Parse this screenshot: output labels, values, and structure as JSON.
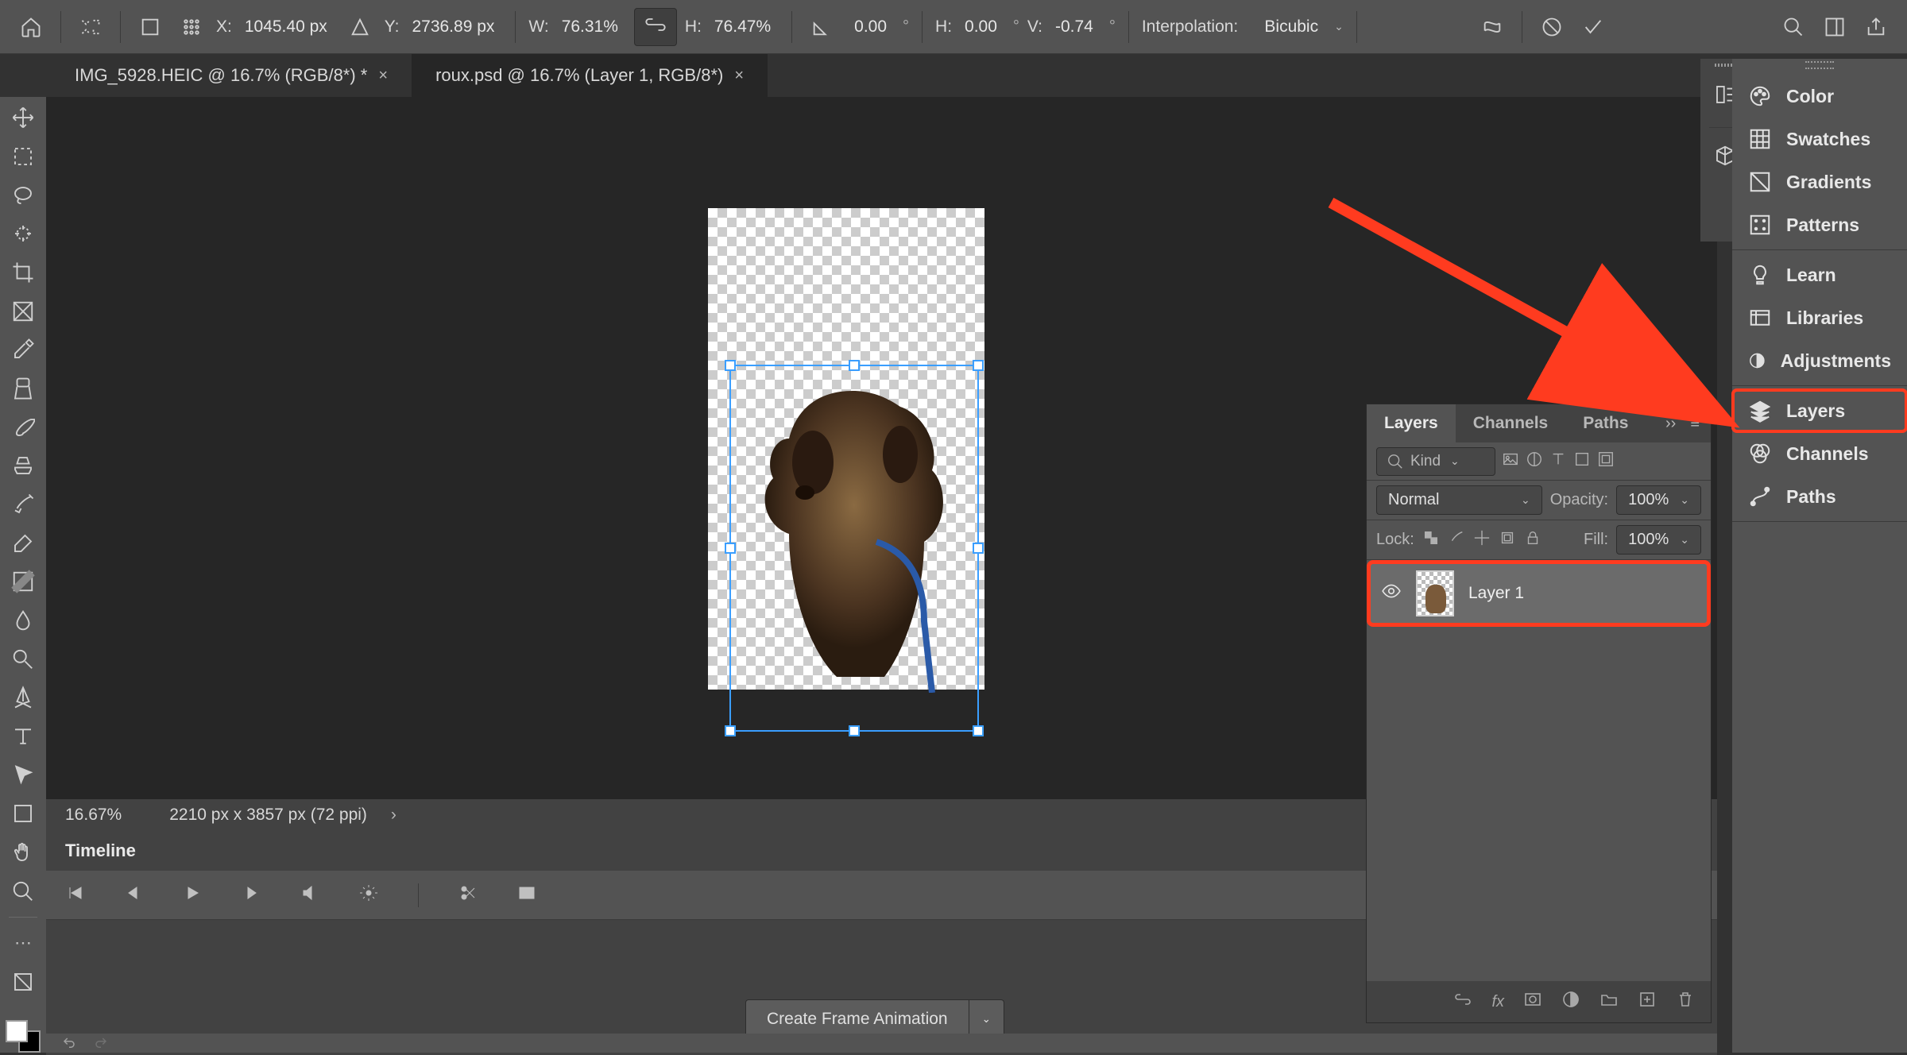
{
  "options_bar": {
    "x_label": "X:",
    "x_value": "1045.40 px",
    "y_label": "Y:",
    "y_value": "2736.89 px",
    "w_label": "W:",
    "w_value": "76.31%",
    "h_label": "H:",
    "h_value": "76.47%",
    "angle_label": "",
    "angle_value": "0.00",
    "hskew_label": "H:",
    "hskew_value": "0.00",
    "vskew_label": "V:",
    "vskew_value": "-0.74",
    "interp_label": "Interpolation:",
    "interp_value": "Bicubic"
  },
  "tabs": [
    {
      "title": "IMG_5928.HEIC @ 16.7% (RGB/8*) *",
      "active": false
    },
    {
      "title": "roux.psd @ 16.7% (Layer 1, RGB/8*)",
      "active": true
    }
  ],
  "status": {
    "zoom": "16.67%",
    "dims": "2210 px x 3857 px (72 ppi)"
  },
  "timeline": {
    "title": "Timeline",
    "create_btn": "Create Frame Animation"
  },
  "right_panels": {
    "group1": [
      "Color",
      "Swatches",
      "Gradients",
      "Patterns"
    ],
    "group2": [
      "Learn",
      "Libraries",
      "Adjustments"
    ],
    "group3": [
      "Layers",
      "Channels",
      "Paths"
    ]
  },
  "layers_panel": {
    "tabs": [
      "Layers",
      "Channels",
      "Paths"
    ],
    "filter_kind": "Kind",
    "blend_mode": "Normal",
    "opacity_label": "Opacity:",
    "opacity_value": "100%",
    "lock_label": "Lock:",
    "fill_label": "Fill:",
    "fill_value": "100%",
    "layer_name": "Layer 1"
  }
}
